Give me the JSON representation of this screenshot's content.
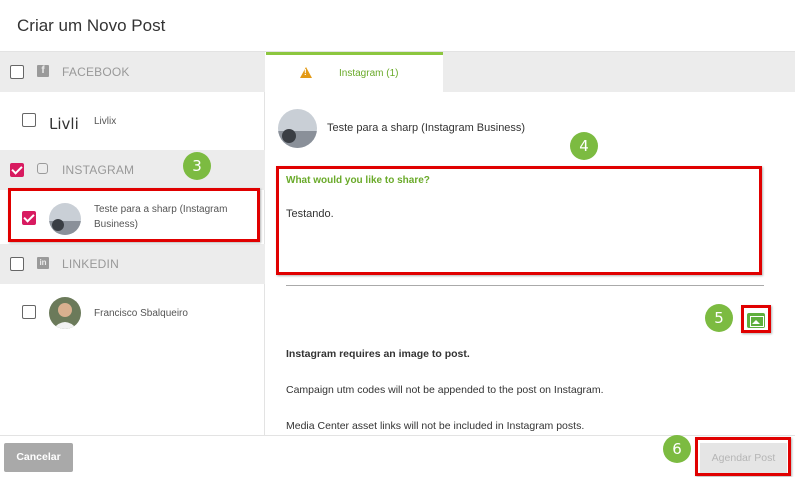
{
  "header": {
    "title": "Criar um Novo Post"
  },
  "left": {
    "networks": [
      {
        "label": "FACEBOOK",
        "icon": "facebook-icon",
        "checked": false
      },
      {
        "label": "INSTAGRAM",
        "icon": "instagram-icon",
        "checked": true
      },
      {
        "label": "LINKEDIN",
        "icon": "linkedin-icon",
        "checked": false
      }
    ],
    "accounts": {
      "facebook": {
        "name": "Livlix",
        "logo_text": "Livli",
        "checked": false
      },
      "instagram": {
        "name": "Teste para a sharp (Instagram Business)",
        "checked": true
      },
      "linkedin": {
        "name": "Francisco Sbalqueiro",
        "checked": false
      }
    }
  },
  "right": {
    "tab": {
      "label": "Instagram (1)",
      "icon": "warning-icon"
    },
    "account_name": "Teste para a sharp (Instagram Business)",
    "compose": {
      "prompt": "What would you like to share?",
      "text": "Testando."
    },
    "image_button_icon": "image-icon",
    "notices": [
      "Instagram requires an image to post.",
      "Campaign utm codes will not be appended to the post on Instagram.",
      "Media Center asset links will not be included in Instagram posts."
    ]
  },
  "footer": {
    "cancel_label": "Cancelar",
    "schedule_label": "Agendar Post"
  },
  "annotations": {
    "badges": [
      "3",
      "4",
      "5",
      "6"
    ],
    "highlight_color": "#e00000",
    "badge_color": "#7cbb41"
  },
  "colors": {
    "accent_green": "#8cc63f",
    "check_pink": "#d81b60",
    "warning": "#e39a16"
  }
}
